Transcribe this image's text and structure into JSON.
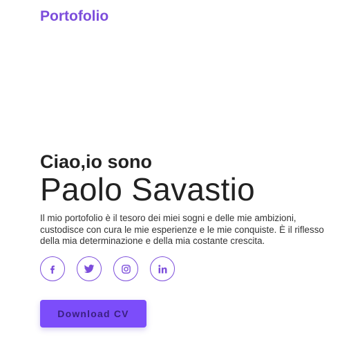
{
  "header": {
    "brand": "Portofolio"
  },
  "hero": {
    "greeting": "Ciao,io sono",
    "name": "Paolo Savastio",
    "bio": "Il mio portofolio è il tesoro dei miei sogni e delle mie ambizioni, custodisce con cura le mie esperienze e le mie conquiste. È il riflesso della mia determinazione e della mia costante crescita."
  },
  "socials": [
    {
      "icon": "facebook-icon"
    },
    {
      "icon": "twitter-icon"
    },
    {
      "icon": "instagram-icon"
    },
    {
      "icon": "linkedin-icon"
    }
  ],
  "cta": {
    "download_label": "Download CV"
  },
  "colors": {
    "accent": "#7c4ddb",
    "button": "#7c4dfa",
    "button_text": "#3a1f80",
    "text": "#222222"
  }
}
